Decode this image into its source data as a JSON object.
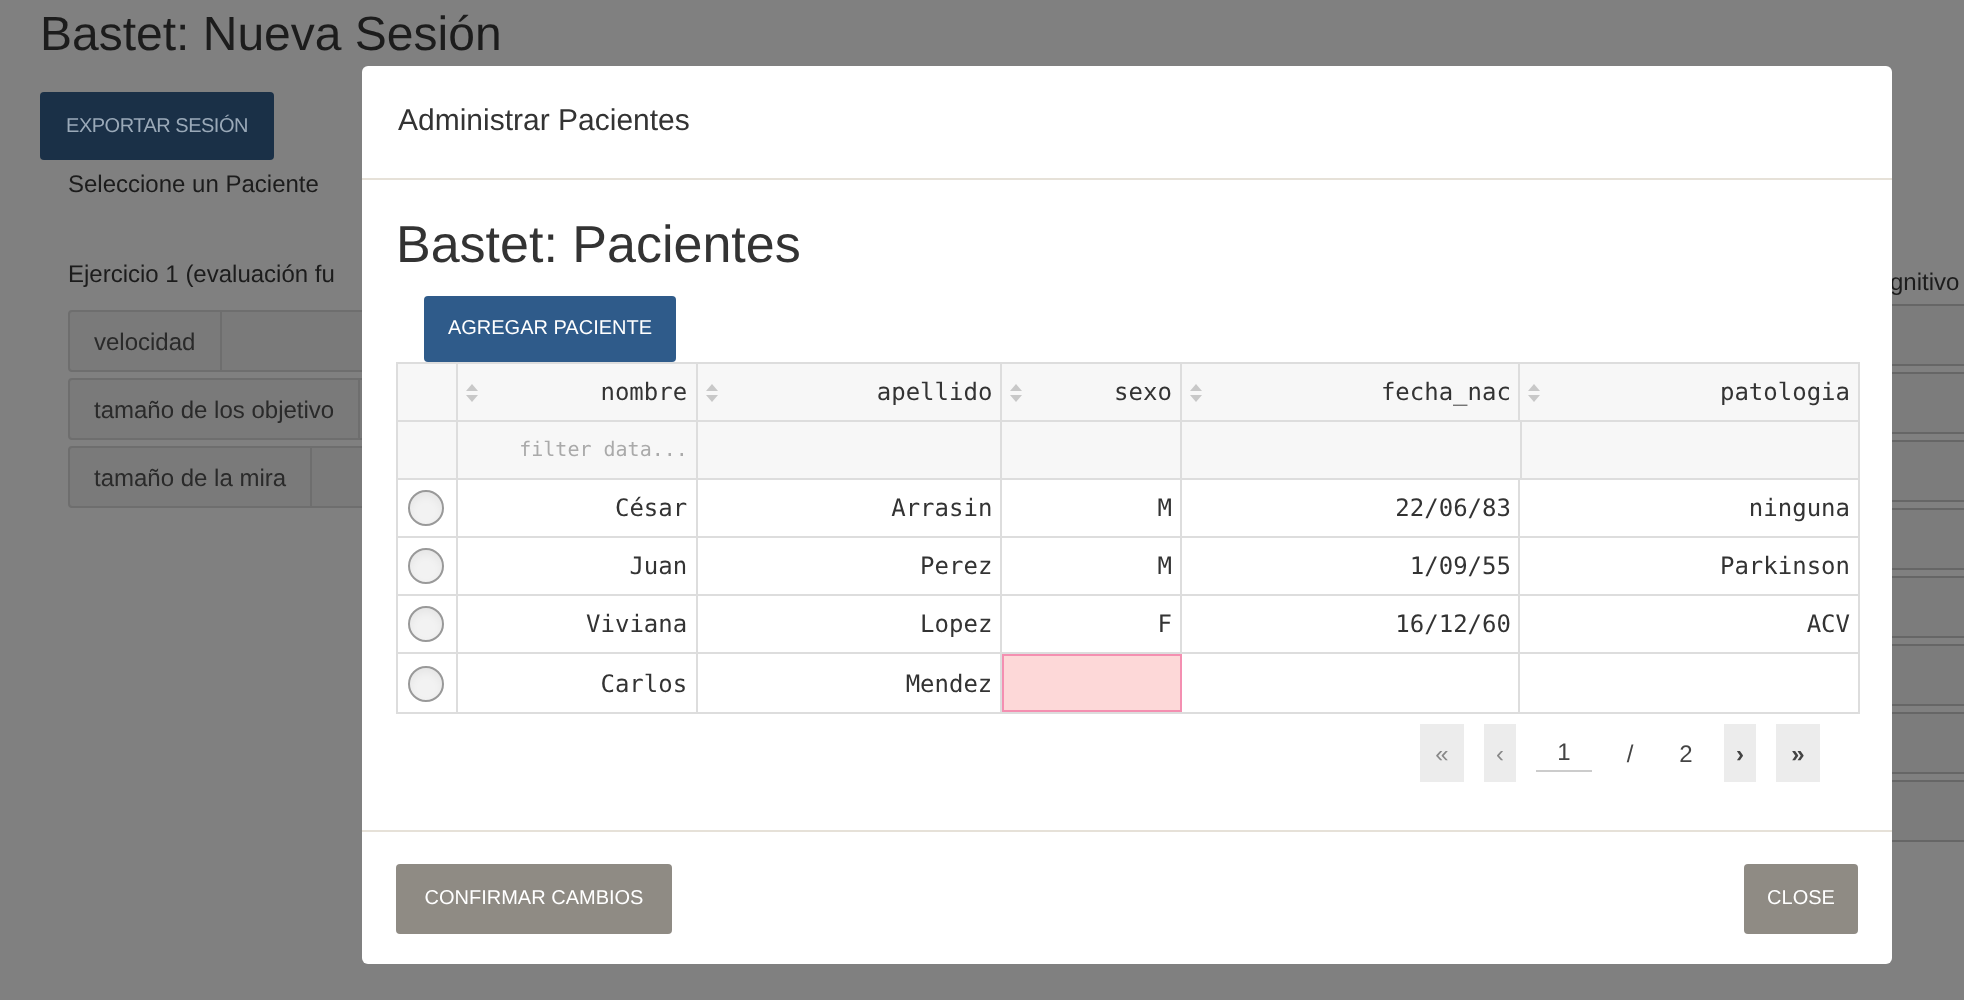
{
  "page": {
    "title": "Bastet: Nueva Sesión",
    "export_button": "EXPORTAR SESIÓN",
    "patient_prompt": "Seleccione un Paciente",
    "exercise_left": "Ejercicio 1 (evaluación fu",
    "exercise_right": "gnitivo",
    "params": [
      "velocidad",
      "tamaño de los objetivo",
      "tamaño de la mira"
    ]
  },
  "modal": {
    "title": "Administrar Pacientes",
    "heading": "Bastet: Pacientes",
    "add_button": "AGREGAR PACIENTE",
    "table": {
      "columns": [
        "nombre",
        "apellido",
        "sexo",
        "fecha_nac",
        "patologia"
      ],
      "filter_placeholder": "filter data...",
      "rows": [
        {
          "selected": false,
          "cells": [
            {
              "text": "César",
              "invalid": false
            },
            {
              "text": "Arrasin",
              "invalid": false
            },
            {
              "text": "M",
              "invalid": false
            },
            {
              "text": "22/06/83",
              "invalid": false
            },
            {
              "text": "ninguna",
              "invalid": false
            }
          ]
        },
        {
          "selected": false,
          "cells": [
            {
              "text": "Juan",
              "invalid": false
            },
            {
              "text": "Perez",
              "invalid": false
            },
            {
              "text": "M",
              "invalid": false
            },
            {
              "text": "1/09/55",
              "invalid": false
            },
            {
              "text": "Parkinson",
              "invalid": false
            }
          ]
        },
        {
          "selected": false,
          "cells": [
            {
              "text": "Viviana",
              "invalid": false
            },
            {
              "text": "Lopez",
              "invalid": false
            },
            {
              "text": "F",
              "invalid": false
            },
            {
              "text": "16/12/60",
              "invalid": false
            },
            {
              "text": "ACV",
              "invalid": false
            }
          ]
        },
        {
          "selected": false,
          "cells": [
            {
              "text": "Carlos",
              "invalid": false
            },
            {
              "text": "Mendez",
              "invalid": false
            },
            {
              "text": "",
              "invalid": true
            },
            {
              "text": "",
              "invalid": false
            },
            {
              "text": "",
              "invalid": false
            }
          ]
        }
      ]
    },
    "pagination": {
      "first": "«",
      "prev": "‹",
      "page": "1",
      "separator": "/",
      "total": "2",
      "next": "›",
      "last": "»"
    },
    "confirm_button": "CONFIRMAR CAMBIOS",
    "close_button": "CLOSE"
  }
}
